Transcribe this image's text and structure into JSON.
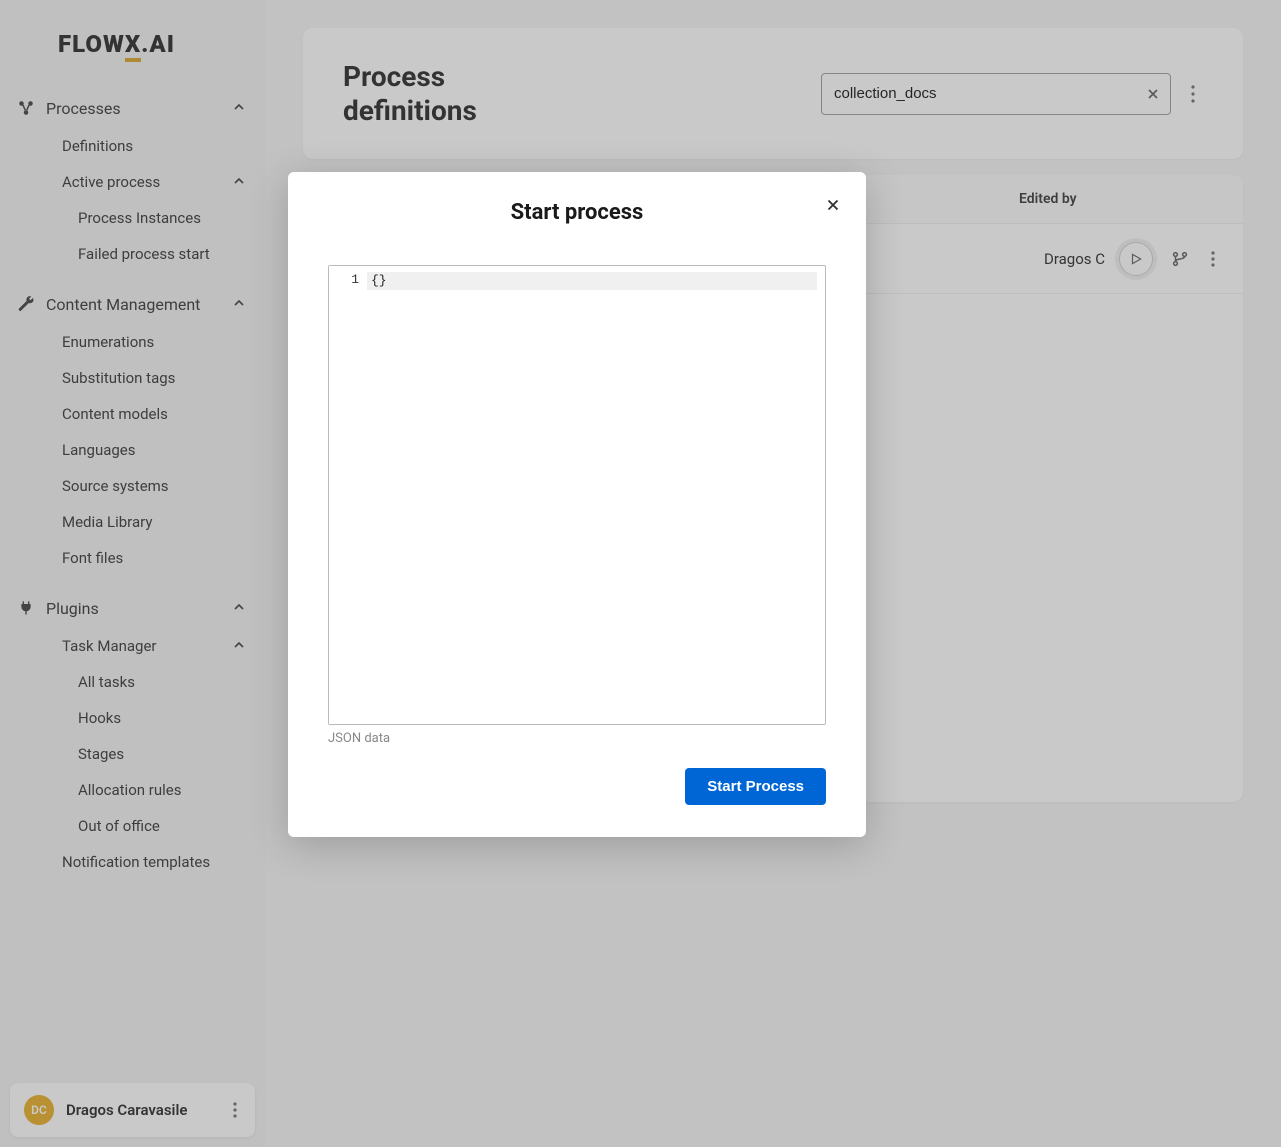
{
  "logo": {
    "text_left": "FLOW",
    "text_x": "X",
    "text_right": ".AI"
  },
  "sidebar": {
    "processes": {
      "label": "Processes",
      "definitions": "Definitions",
      "active_process": "Active process",
      "process_instances": "Process Instances",
      "failed_process_start": "Failed process start"
    },
    "content_mgmt": {
      "label": "Content Management",
      "enumerations": "Enumerations",
      "substitution_tags": "Substitution tags",
      "content_models": "Content models",
      "languages": "Languages",
      "source_systems": "Source systems",
      "media_library": "Media Library",
      "font_files": "Font files"
    },
    "plugins": {
      "label": "Plugins",
      "task_manager": "Task Manager",
      "all_tasks": "All tasks",
      "hooks": "Hooks",
      "stages": "Stages",
      "allocation_rules": "Allocation rules",
      "out_of_office": "Out of office",
      "notification_templates": "Notification templates"
    }
  },
  "user": {
    "initials": "DC",
    "name": "Dragos Caravasile"
  },
  "header": {
    "title": "Process definitions",
    "search_value": "collection_docs"
  },
  "table": {
    "col_edited_by": "Edited by",
    "row_editor": "Dragos C"
  },
  "modal": {
    "title": "Start process",
    "line_number": "1",
    "code_content": "{}",
    "editor_label": "JSON data",
    "start_button": "Start Process"
  }
}
